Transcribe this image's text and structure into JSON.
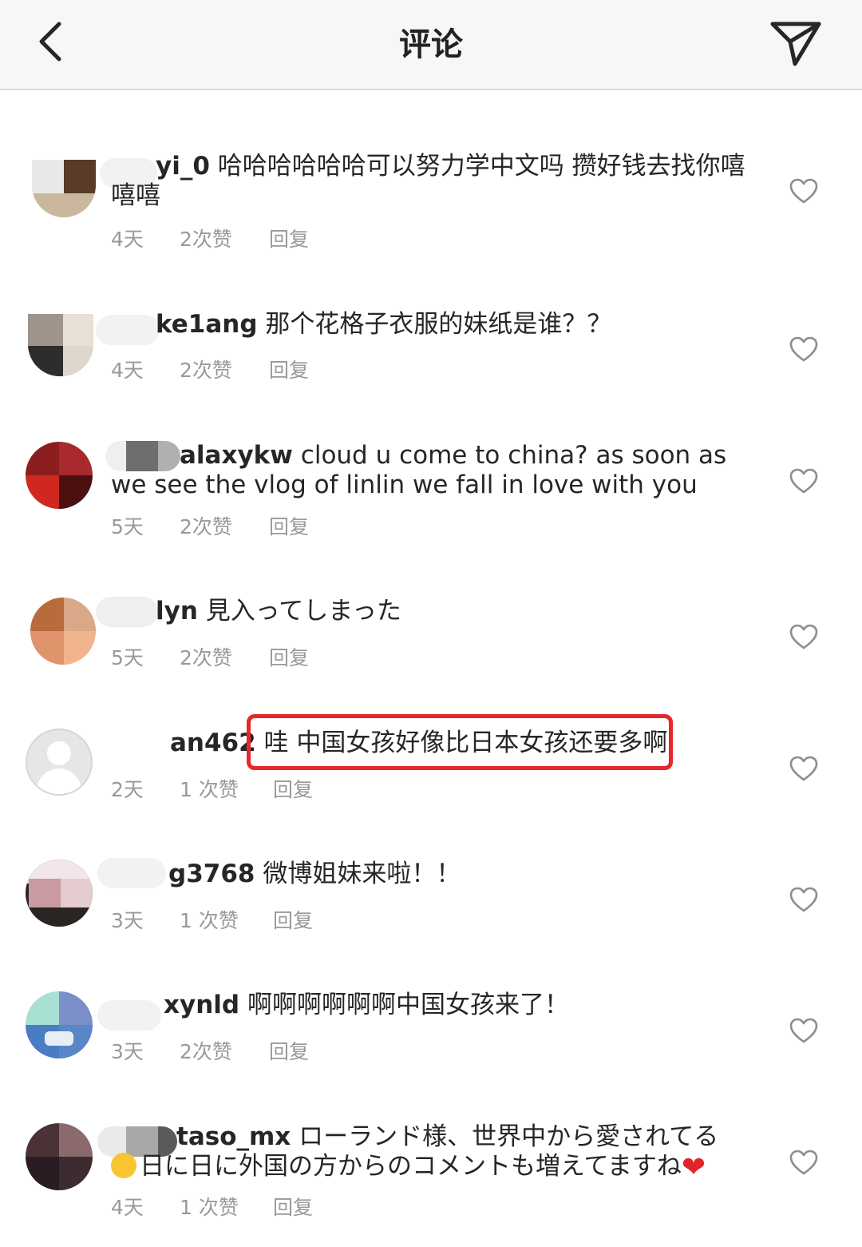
{
  "header": {
    "title": "评论",
    "back_icon": "chevron-left-icon",
    "share_icon": "send-icon"
  },
  "colors": {
    "highlight": "#e8262c",
    "meta_text": "#999999",
    "header_bg": "#f7f7f7"
  },
  "comments": [
    {
      "username": "yi_0",
      "text": "哈哈哈哈哈哈可以努力学中文吗 攒好钱去找你嘻嘻嘻",
      "time": "4天",
      "likes": "2次赞",
      "reply": "回复"
    },
    {
      "username": "ke1ang",
      "text": "那个花格子衣服的妹纸是谁？？",
      "time": "4天",
      "likes": "2次赞",
      "reply": "回复"
    },
    {
      "username": "alaxykw",
      "text": "cloud u come to china?  as soon as we see the vlog of linlin we fall in love with you",
      "time": "5天",
      "likes": "2次赞",
      "reply": "回复"
    },
    {
      "username": "lyn",
      "text": "見入ってしまった",
      "time": "5天",
      "likes": "2次赞",
      "reply": "回复"
    },
    {
      "username": "an462",
      "text": "哇 中国女孩好像比日本女孩还要多啊",
      "time": "2天",
      "likes": "1 次赞",
      "reply": "回复"
    },
    {
      "username": "g3768",
      "text": "微博姐妹来啦！！",
      "time": "3天",
      "likes": "1 次赞",
      "reply": "回复"
    },
    {
      "username": "xynld",
      "text": "啊啊啊啊啊啊中国女孩来了！",
      "time": "3天",
      "likes": "2次赞",
      "reply": "回复"
    },
    {
      "username": "taso_mx",
      "text": "ローランド様、世界中から愛されてる",
      "text_line2": "日に日に外国の方からのコメントも増えてますね",
      "time": "4天",
      "likes": "1 次赞",
      "reply": "回复"
    }
  ]
}
